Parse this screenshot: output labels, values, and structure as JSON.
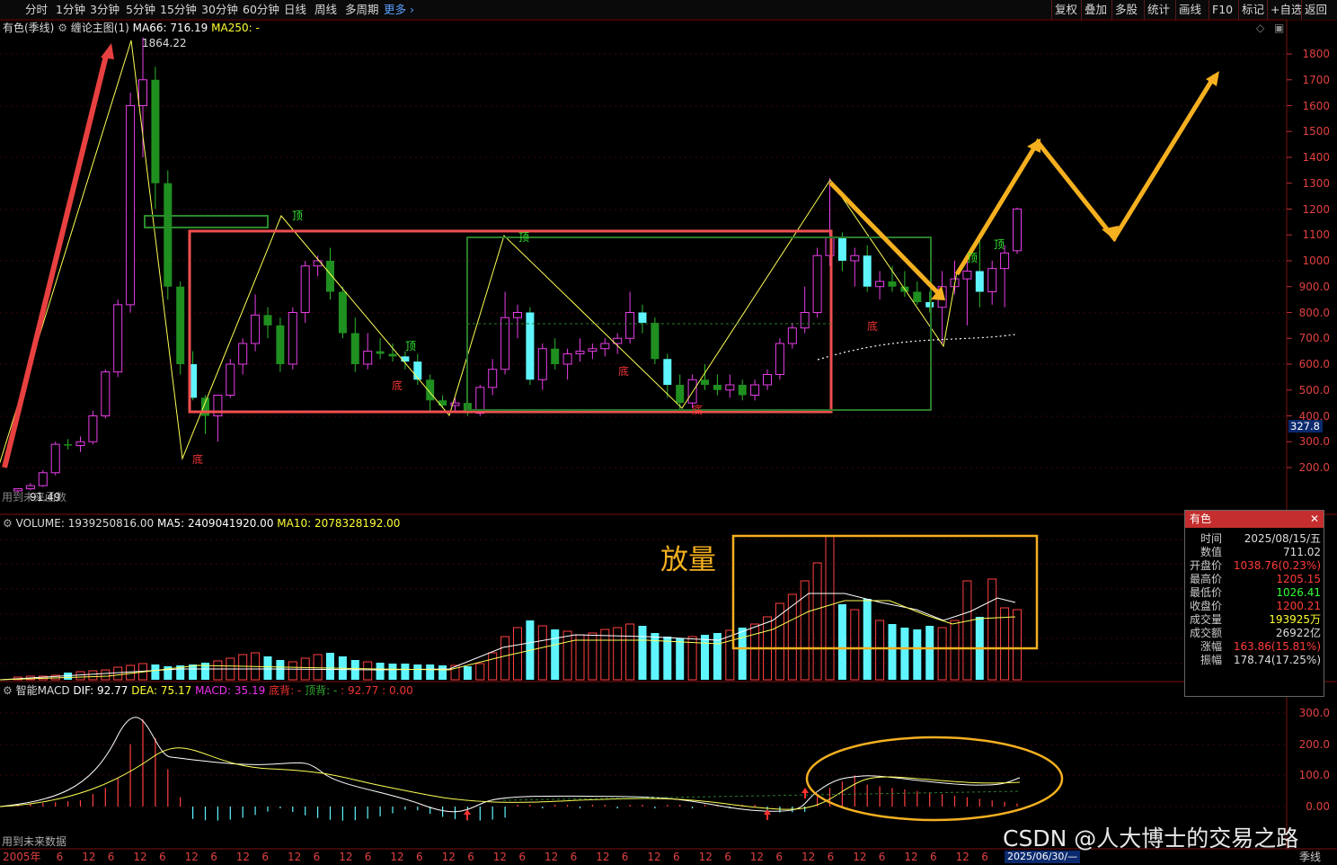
{
  "toolbar": {
    "left": [
      "分时",
      "1分钟",
      "3分钟",
      "5分钟",
      "15分钟",
      "30分钟",
      "60分钟",
      "日线",
      "周线",
      "多周期"
    ],
    "more": "更多",
    "right": [
      "复权",
      "叠加",
      "多股",
      "统计",
      "画线",
      "F10",
      "标记",
      "+自选",
      "返回"
    ]
  },
  "main_legend": {
    "symbol": "有色(季线)",
    "indicator": "缠论主图(1)",
    "ma66": "MA66: 716.19",
    "ma250": "MA250: -"
  },
  "main_annotations": {
    "peak_label": "1864.22",
    "low_label": "91.49",
    "future_note": "用到未来函数",
    "tops": [
      "顶",
      "顶",
      "顶",
      "顶",
      "顶"
    ],
    "bottoms": [
      "底",
      "底",
      "底",
      "底",
      "底"
    ],
    "price_tag": "327.8"
  },
  "price_axis": [
    "1800",
    "1700",
    "1600",
    "1500",
    "1400",
    "1300",
    "1200",
    "1100",
    "1000",
    "900.0",
    "800.0",
    "700.0",
    "600.0",
    "500.0",
    "400.0",
    "300.0",
    "200.0"
  ],
  "volume_legend": {
    "label": "VOLUME: 1939250816.00",
    "ma5": "MA5: 2409041920.00",
    "ma10": "MA10: 2078328192.00"
  },
  "volume_note": "放量",
  "macd_legend": {
    "label": "智能MACD",
    "dif": "DIF: 92.77",
    "dea": "DEA: 75.17",
    "macd": "MACD: 35.19",
    "bottom_div": "底背: -",
    "top_div": "顶背: -",
    "extra": ": 92.77 : 0.00"
  },
  "macd_axis": [
    "300.0",
    "200.0",
    "100.0",
    "0.00"
  ],
  "macd_note": "用到未来数据",
  "time_axis": [
    "2005年",
    "6",
    "12",
    "6",
    "12",
    "6",
    "12",
    "6",
    "12",
    "6",
    "12",
    "6",
    "12",
    "6",
    "12",
    "6",
    "12",
    "6",
    "12",
    "6",
    "12",
    "6",
    "12",
    "6",
    "12",
    "6",
    "12",
    "6",
    "12",
    "6",
    "12",
    "6",
    "12",
    "6",
    "12",
    "6",
    "12",
    "6",
    "12"
  ],
  "time_tag": "2025/06/30/—",
  "period_label": "季线",
  "watermark": "CSDN @人大博士的交易之路",
  "info_panel": {
    "title": "有色",
    "rows": [
      {
        "k": "时间",
        "v": "2025/08/15/五",
        "c": "#ddd"
      },
      {
        "k": "数值",
        "v": "711.02",
        "c": "#ddd"
      },
      {
        "k": "开盘价",
        "v": "1038.76(0.23%)",
        "c": "#ff3b3b"
      },
      {
        "k": "最高价",
        "v": "1205.15",
        "c": "#ff3b3b"
      },
      {
        "k": "最低价",
        "v": "1026.41",
        "c": "#33ff33"
      },
      {
        "k": "收盘价",
        "v": "1200.21",
        "c": "#ff3b3b"
      },
      {
        "k": "成交量",
        "v": "193925万",
        "c": "#ffff33"
      },
      {
        "k": "成交额",
        "v": "26922亿",
        "c": "#ddd"
      },
      {
        "k": "涨幅",
        "v": "163.86(15.81%)",
        "c": "#ff3b3b"
      },
      {
        "k": "振幅",
        "v": "178.74(17.25%)",
        "c": "#ddd"
      }
    ]
  },
  "chart_data": {
    "type": "candlestick",
    "period": "quarterly",
    "candles": [
      [
        110,
        120,
        100,
        118
      ],
      [
        118,
        140,
        112,
        130
      ],
      [
        130,
        190,
        125,
        180
      ],
      [
        180,
        300,
        170,
        290
      ],
      [
        290,
        310,
        270,
        285
      ],
      [
        285,
        320,
        260,
        300
      ],
      [
        300,
        420,
        290,
        400
      ],
      [
        400,
        580,
        390,
        570
      ],
      [
        570,
        850,
        550,
        830
      ],
      [
        830,
        1650,
        800,
        1600
      ],
      [
        1600,
        1864,
        1400,
        1700
      ],
      [
        1700,
        1750,
        1200,
        1300
      ],
      [
        1300,
        1350,
        850,
        900
      ],
      [
        900,
        920,
        560,
        600
      ],
      [
        600,
        650,
        460,
        470
      ],
      [
        470,
        480,
        330,
        400
      ],
      [
        400,
        420,
        300,
        480
      ],
      [
        480,
        620,
        470,
        600
      ],
      [
        600,
        700,
        560,
        680
      ],
      [
        680,
        870,
        650,
        790
      ],
      [
        790,
        820,
        700,
        750
      ],
      [
        750,
        780,
        570,
        600
      ],
      [
        600,
        820,
        580,
        800
      ],
      [
        800,
        1000,
        760,
        980
      ],
      [
        980,
        1020,
        940,
        1000
      ],
      [
        1000,
        1050,
        850,
        880
      ],
      [
        880,
        900,
        700,
        720
      ],
      [
        720,
        780,
        570,
        600
      ],
      [
        600,
        720,
        580,
        650
      ],
      [
        650,
        700,
        620,
        640
      ],
      [
        640,
        680,
        610,
        630
      ],
      [
        630,
        650,
        580,
        610
      ],
      [
        610,
        640,
        520,
        540
      ],
      [
        540,
        560,
        420,
        460
      ],
      [
        460,
        480,
        430,
        440
      ],
      [
        440,
        470,
        420,
        450
      ],
      [
        450,
        460,
        400,
        410
      ],
      [
        410,
        520,
        400,
        510
      ],
      [
        510,
        620,
        480,
        580
      ],
      [
        580,
        880,
        560,
        780
      ],
      [
        780,
        830,
        700,
        800
      ],
      [
        800,
        820,
        520,
        540
      ],
      [
        540,
        680,
        500,
        660
      ],
      [
        660,
        700,
        580,
        600
      ],
      [
        600,
        660,
        540,
        640
      ],
      [
        640,
        700,
        610,
        650
      ],
      [
        650,
        680,
        620,
        660
      ],
      [
        660,
        700,
        630,
        680
      ],
      [
        680,
        720,
        640,
        700
      ],
      [
        700,
        880,
        680,
        800
      ],
      [
        800,
        830,
        720,
        760
      ],
      [
        760,
        780,
        600,
        620
      ],
      [
        620,
        640,
        470,
        520
      ],
      [
        520,
        560,
        420,
        450
      ],
      [
        450,
        560,
        430,
        540
      ],
      [
        540,
        600,
        500,
        520
      ],
      [
        520,
        560,
        480,
        500
      ],
      [
        500,
        560,
        470,
        520
      ],
      [
        520,
        540,
        460,
        480
      ],
      [
        480,
        540,
        460,
        520
      ],
      [
        520,
        580,
        500,
        560
      ],
      [
        560,
        700,
        540,
        680
      ],
      [
        680,
        760,
        660,
        740
      ],
      [
        740,
        900,
        720,
        800
      ],
      [
        800,
        1050,
        780,
        1020
      ],
      [
        1020,
        1320,
        980,
        1090
      ],
      [
        1090,
        1110,
        960,
        1000
      ],
      [
        1000,
        1050,
        900,
        1020
      ],
      [
        1020,
        1060,
        880,
        900
      ],
      [
        900,
        960,
        850,
        920
      ],
      [
        920,
        980,
        880,
        900
      ],
      [
        900,
        960,
        860,
        880
      ],
      [
        880,
        920,
        830,
        840
      ],
      [
        840,
        880,
        800,
        820
      ],
      [
        820,
        960,
        680,
        900
      ],
      [
        900,
        1000,
        870,
        930
      ],
      [
        930,
        1020,
        750,
        960
      ],
      [
        960,
        1090,
        820,
        880
      ],
      [
        880,
        1000,
        830,
        970
      ],
      [
        970,
        1060,
        820,
        1030
      ],
      [
        1038.76,
        1205.15,
        1026.41,
        1200.21
      ]
    ],
    "ma66_last": 716.19,
    "volume_last": 1939250816.0,
    "ma5_last": 2409041920.0,
    "ma10_last": 2078328192.0,
    "dif_last": 92.77,
    "dea_last": 75.17,
    "macd_last": 35.19,
    "price_range": [
      100,
      1900
    ],
    "macd_range": [
      -50,
      300
    ]
  }
}
